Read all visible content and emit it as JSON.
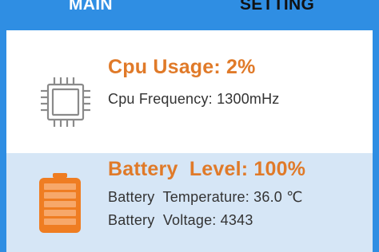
{
  "tabs": {
    "main_label": "MAIN",
    "setting_label": "SETTING"
  },
  "cpu": {
    "icon": "cpu-chip-icon",
    "usage_text": "Cpu Usage: 2%",
    "frequency_text": "Cpu Frequency: 1300mHz"
  },
  "battery": {
    "icon": "battery-icon",
    "level_text": "Battery  Level: 100%",
    "temperature_text": "Battery  Temperature: 36.0 ℃",
    "voltage_text": "Battery  Voltage: 4343"
  },
  "colors": {
    "accent": "#2f8ee3",
    "headline": "#e07a29",
    "battery_card_bg": "#d6e6f6"
  }
}
